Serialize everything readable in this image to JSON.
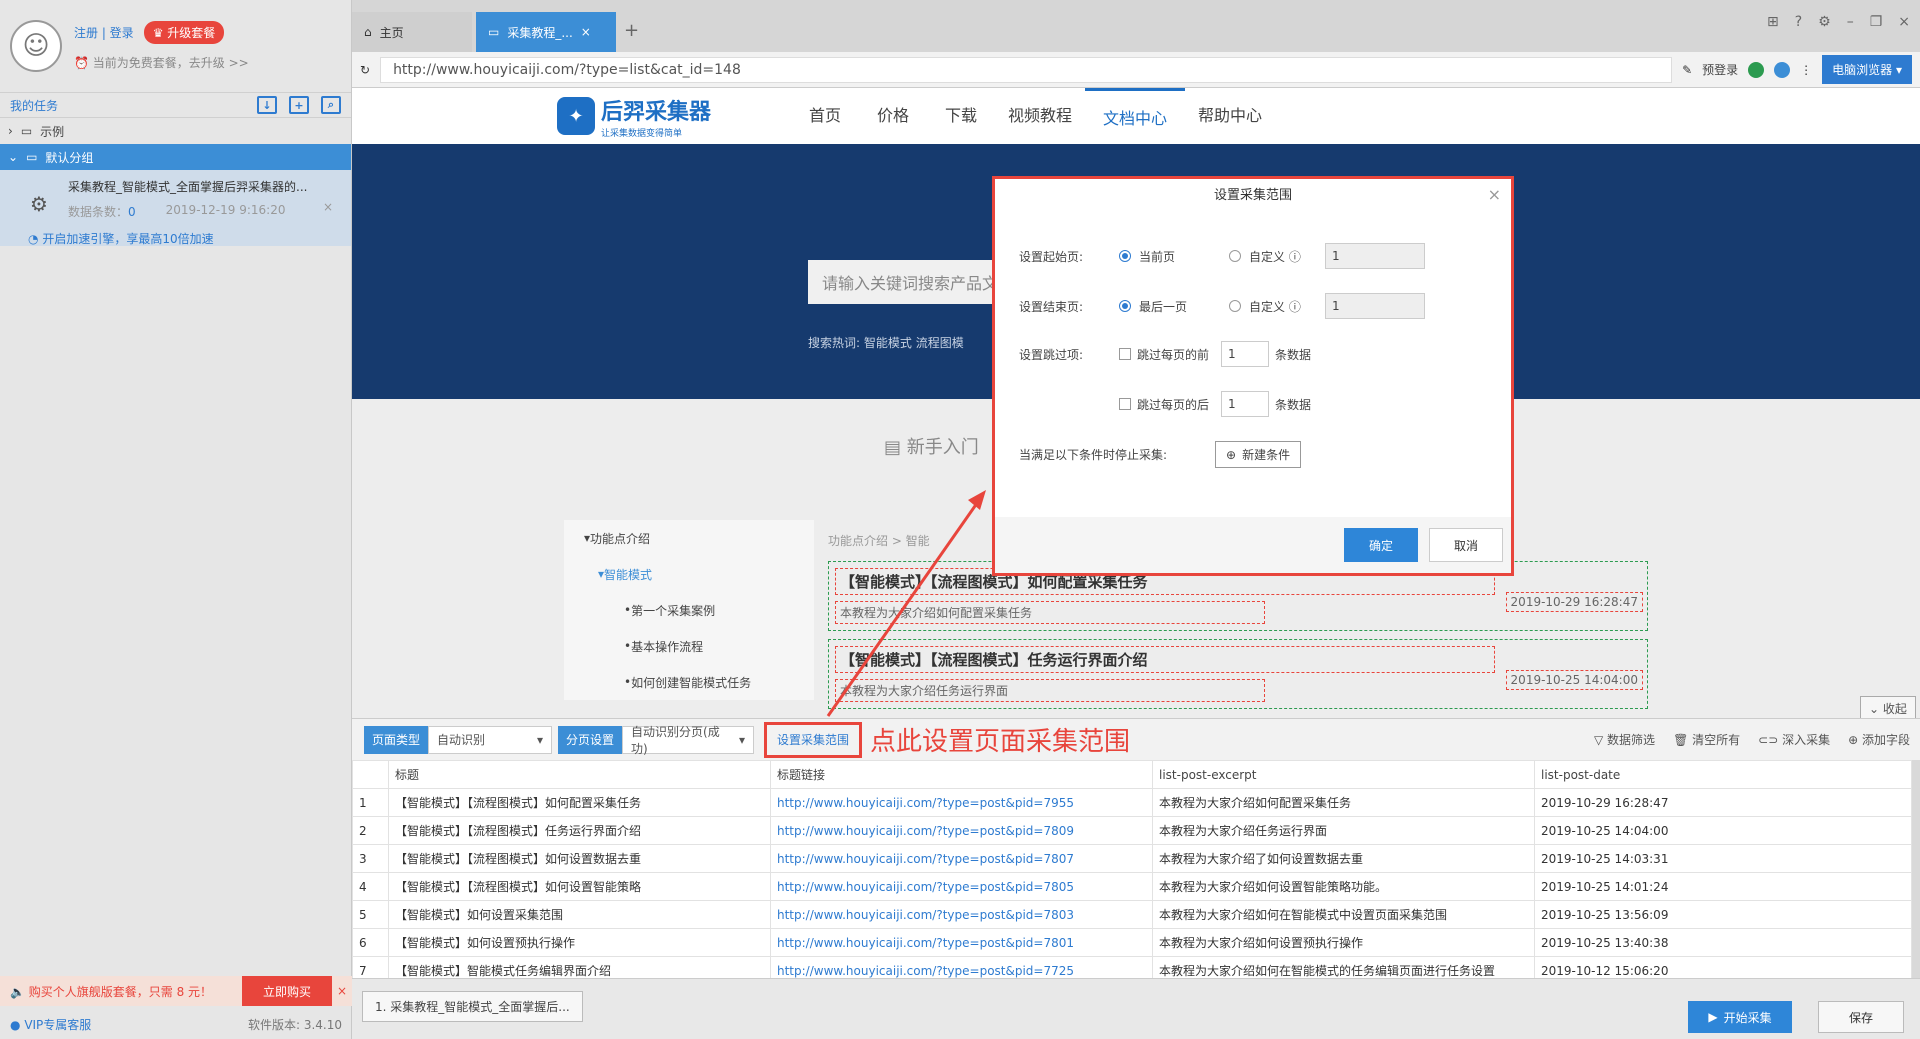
{
  "sidebar": {
    "register_login": "注册 | 登录",
    "upgrade": "升级套餐",
    "plan_note": "当前为免费套餐，去升级 >>",
    "my_tasks": "我的任务",
    "groups": [
      {
        "label": "示例"
      },
      {
        "label": "默认分组"
      }
    ],
    "task": {
      "title": "采集教程_智能模式_全面掌握后羿采集器的...",
      "count_label": "数据条数：",
      "count": "0",
      "time": "2019-12-19 9:16:20",
      "speed": "开启加速引擎，享最高10倍加速"
    },
    "promo": {
      "text": "购买个人旗舰版套餐，只需 8 元！",
      "button": "立即购买"
    },
    "vip": "VIP专属客服",
    "version": "软件版本: 3.4.10"
  },
  "tabs": [
    {
      "label": "主页"
    },
    {
      "label": "采集教程_..."
    }
  ],
  "address": {
    "url": "http://www.houyicaiji.com/?type=list&cat_id=148",
    "prelogin": "预登录",
    "browser": "电脑浏览器"
  },
  "site": {
    "logo_text": "后羿采集器",
    "logo_sub": "让采集数据变得简单",
    "nav": [
      {
        "label": "首页"
      },
      {
        "label": "价格"
      },
      {
        "label": "下载"
      },
      {
        "label": "视频教程"
      },
      {
        "label": "文档中心"
      },
      {
        "label": "帮助中心"
      }
    ],
    "search_placeholder": "请输入关键词搜索产品文",
    "hot_label": "搜索热词:",
    "hot_words": "智能模式  流程图模",
    "newbie": "新手入门",
    "menu": [
      {
        "label": "功能点介绍"
      },
      {
        "label": "智能模式"
      },
      {
        "label": "第一个采集案例"
      },
      {
        "label": "基本操作流程"
      },
      {
        "label": "如何创建智能模式任务"
      }
    ],
    "crumb": "功能点介绍 > 智能",
    "articles": [
      {
        "title": "【智能模式】【流程图模式】如何配置采集任务",
        "excerpt": "本教程为大家介绍如何配置采集任务",
        "date": "2019-10-29 16:28:47"
      },
      {
        "title": "【智能模式】【流程图模式】任务运行界面介绍",
        "excerpt": "本教程为大家介绍任务运行界面",
        "date": "2019-10-25 14:04:00"
      }
    ],
    "collapse": "收起"
  },
  "modal": {
    "title": "设置采集范围",
    "start_label": "设置起始页:",
    "start_opt1": "当前页",
    "start_opt2": "自定义",
    "start_value": "1",
    "end_label": "设置结束页:",
    "end_opt1": "最后一页",
    "end_opt2": "自定义",
    "end_value": "1",
    "skip_label": "设置跳过项:",
    "skip_front": "跳过每页的前",
    "skip_front_value": "1",
    "skip_back": "跳过每页的后",
    "skip_back_value": "1",
    "unit": "条数据",
    "stop_label": "当满足以下条件时停止采集:",
    "new_condition": "新建条件",
    "ok": "确定",
    "cancel": "取消"
  },
  "toolbar": {
    "page_type_label": "页面类型",
    "page_type_value": "自动识别",
    "paging_label": "分页设置",
    "paging_value": "自动识别分页(成功)",
    "range_link": "设置采集范围",
    "annotation": "点此设置页面采集范围",
    "filter": "数据筛选",
    "clear": "清空所有",
    "deep": "深入采集",
    "add_field": "添加字段"
  },
  "table": {
    "headers": [
      "",
      "标题",
      "标题链接",
      "list-post-excerpt",
      "list-post-date"
    ],
    "rows": [
      [
        "1",
        "【智能模式】【流程图模式】如何配置采集任务",
        "http://www.houyicaiji.com/?type=post&pid=7955",
        "本教程为大家介绍如何配置采集任务",
        "2019-10-29 16:28:47"
      ],
      [
        "2",
        "【智能模式】【流程图模式】任务运行界面介绍",
        "http://www.houyicaiji.com/?type=post&pid=7809",
        "本教程为大家介绍任务运行界面",
        "2019-10-25 14:04:00"
      ],
      [
        "3",
        "【智能模式】【流程图模式】如何设置数据去重",
        "http://www.houyicaiji.com/?type=post&pid=7807",
        "本教程为大家介绍了如何设置数据去重",
        "2019-10-25 14:03:31"
      ],
      [
        "4",
        "【智能模式】【流程图模式】如何设置智能策略",
        "http://www.houyicaiji.com/?type=post&pid=7805",
        "本教程为大家介绍如何设置智能策略功能。",
        "2019-10-25 14:01:24"
      ],
      [
        "5",
        "【智能模式】如何设置采集范围",
        "http://www.houyicaiji.com/?type=post&pid=7803",
        "本教程为大家介绍如何在智能模式中设置页面采集范围",
        "2019-10-25 13:56:09"
      ],
      [
        "6",
        "【智能模式】如何设置预执行操作",
        "http://www.houyicaiji.com/?type=post&pid=7801",
        "本教程为大家介绍如何设置预执行操作",
        "2019-10-25 13:40:38"
      ],
      [
        "7",
        "【智能模式】智能模式任务编辑界面介绍",
        "http://www.houyicaiji.com/?type=post&pid=7725",
        "本教程为大家介绍如何在智能模式的任务编辑页面进行任务设置",
        "2019-10-12 15:06:20"
      ]
    ]
  },
  "bottom": {
    "task_tab": "1. 采集教程_智能模式_全面掌握后...",
    "start": "开始采集",
    "save": "保存"
  }
}
